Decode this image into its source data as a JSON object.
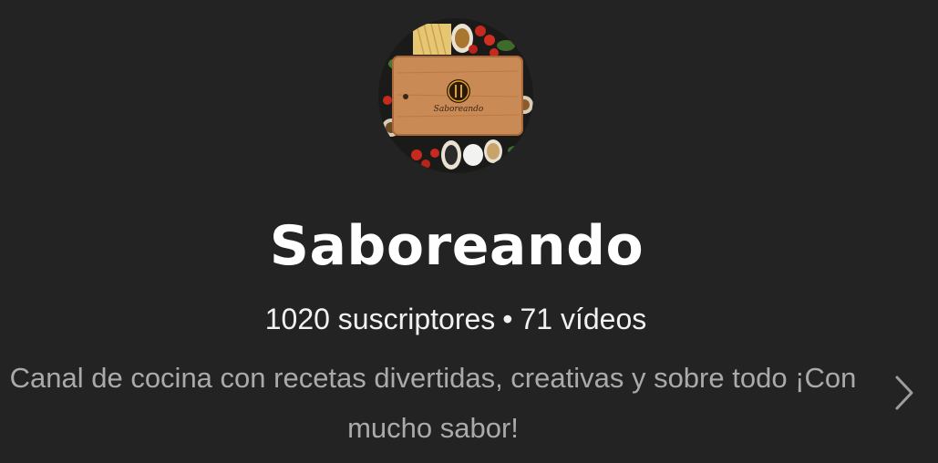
{
  "channel": {
    "name": "Saboreando",
    "avatar_logo_text": "Saboreando",
    "subscribers": "1020 suscriptores",
    "separator": "•",
    "videos": "71 vídeos",
    "description": "Canal de cocina con recetas divertidas, creativas y sobre todo ¡Con mucho sabor!"
  },
  "icons": {
    "more": "chevron-right-icon"
  },
  "colors": {
    "background": "#232323",
    "title": "#ffffff",
    "stats": "#f1f1f1",
    "description": "#aaaaaa",
    "chevron": "#9e9e9e"
  }
}
